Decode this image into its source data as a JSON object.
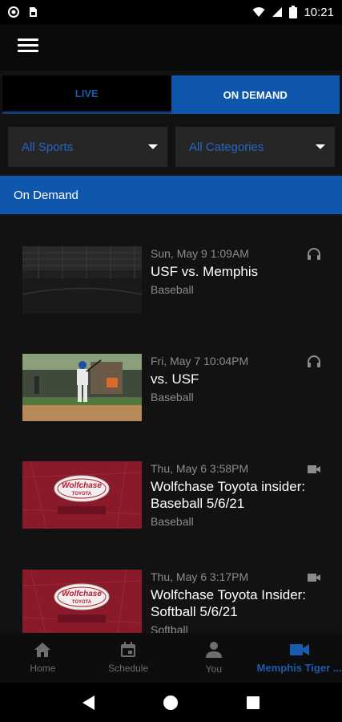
{
  "status_bar": {
    "time": "10:21",
    "icons": [
      "record-icon",
      "sim-card-icon",
      "wifi-icon",
      "cell-signal-icon",
      "battery-icon"
    ]
  },
  "app_bar": {
    "menu_icon": "hamburger-menu-icon"
  },
  "tabs": [
    {
      "label": "LIVE",
      "active": false
    },
    {
      "label": "ON DEMAND",
      "active": true
    }
  ],
  "filters": {
    "sport": "All Sports",
    "category": "All Categories"
  },
  "section_title": "On Demand",
  "items": [
    {
      "date": "Sun, May 9 1:09AM",
      "title": "USF vs. Memphis",
      "category": "Baseball",
      "type_icon": "headphones-icon",
      "thumb": "stadium-dark"
    },
    {
      "date": "Fri, May 7 10:04PM",
      "title": "vs. USF",
      "category": "Baseball",
      "type_icon": "headphones-icon",
      "thumb": "batter-photo"
    },
    {
      "date": "Thu, May 6 3:58PM",
      "title": "Wolfchase Toyota insider: Baseball 5/6/21",
      "category": "Baseball",
      "type_icon": "video-camera-icon",
      "thumb": "wolfchase-toyota"
    },
    {
      "date": "Thu, May 6 3:17PM",
      "title": "Wolfchase Toyota Insider: Softball 5/6/21",
      "category": "Softball",
      "type_icon": "video-camera-icon",
      "thumb": "wolfchase-toyota"
    }
  ],
  "thumb_logo": {
    "line1": "Wolfchase",
    "line2": "TOYOTA"
  },
  "bottom_nav": [
    {
      "label": "Home",
      "icon": "home-icon",
      "active": false
    },
    {
      "label": "Schedule",
      "icon": "calendar-icon",
      "active": false
    },
    {
      "label": "You",
      "icon": "person-icon",
      "active": false
    },
    {
      "label": "Memphis Tiger ...",
      "icon": "video-camera-icon",
      "active": true
    }
  ],
  "system_nav": [
    "back-icon",
    "home-circle-icon",
    "recents-square-icon"
  ],
  "colors": {
    "accent_blue": "#0e57ad",
    "accent_text": "#2566c6",
    "background": "#121212",
    "muted_text": "#8c8c8c"
  }
}
